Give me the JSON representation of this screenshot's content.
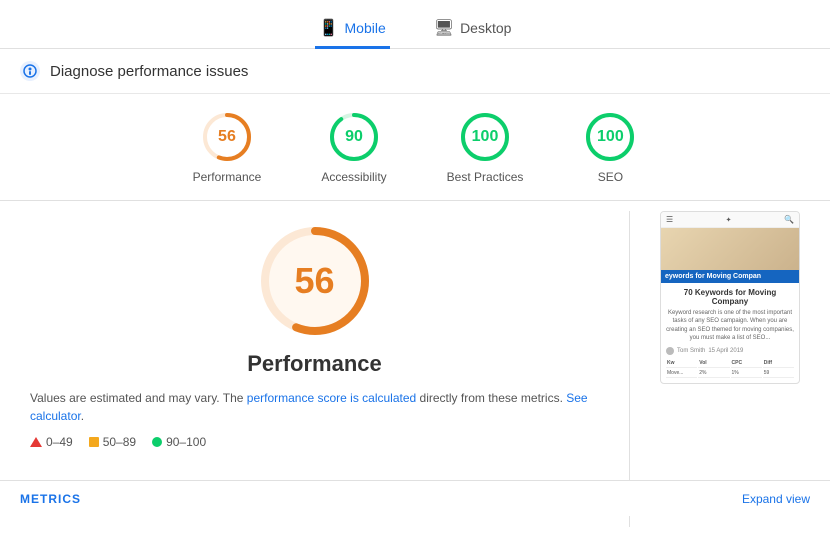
{
  "tabs": [
    {
      "id": "mobile",
      "label": "Mobile",
      "icon": "📱",
      "active": true
    },
    {
      "id": "desktop",
      "label": "Desktop",
      "icon": "🖥",
      "active": false
    }
  ],
  "diagnose": {
    "title": "Diagnose performance issues"
  },
  "scores": [
    {
      "id": "performance",
      "value": 56,
      "label": "Performance",
      "color": "#e67e22",
      "trackColor": "#fce8d5",
      "bgColor": "#fff8f0"
    },
    {
      "id": "accessibility",
      "value": 90,
      "label": "Accessibility",
      "color": "#0cce6b",
      "trackColor": "#d5f5e3",
      "bgColor": "#f0fff8"
    },
    {
      "id": "best-practices",
      "value": 100,
      "label": "Best Practices",
      "color": "#0cce6b",
      "trackColor": "#d5f5e3",
      "bgColor": "#f0fff8"
    },
    {
      "id": "seo",
      "value": 100,
      "label": "SEO",
      "color": "#0cce6b",
      "trackColor": "#d5f5e3",
      "bgColor": "#f0fff8"
    }
  ],
  "bigScore": {
    "value": 56,
    "label": "Performance",
    "color": "#e67e22"
  },
  "description": {
    "text1": "Values are estimated and may vary. The ",
    "link1": "performance score is calculated",
    "text2": " directly from these metrics. ",
    "link2": "See calculator",
    "text3": "."
  },
  "legend": [
    {
      "id": "red",
      "range": "0–49",
      "type": "triangle",
      "color": "#e53935"
    },
    {
      "id": "orange",
      "range": "50–89",
      "type": "square",
      "color": "#f4a81d"
    },
    {
      "id": "green",
      "range": "90–100",
      "type": "circle",
      "color": "#0cce6b"
    }
  ],
  "preview": {
    "heroText": "eywords for Moving Compan",
    "title": "70 Keywords for Moving Company",
    "desc": "Keyword research is one of the most important tasks of any SEO campaign. When you are creating an SEO themed for moving companies, you must make a list of SEO...",
    "author": "Tom Smith",
    "date": "15 April 2019"
  },
  "bottomBar": {
    "metricsLabel": "METRICS",
    "expandLabel": "Expand view"
  }
}
